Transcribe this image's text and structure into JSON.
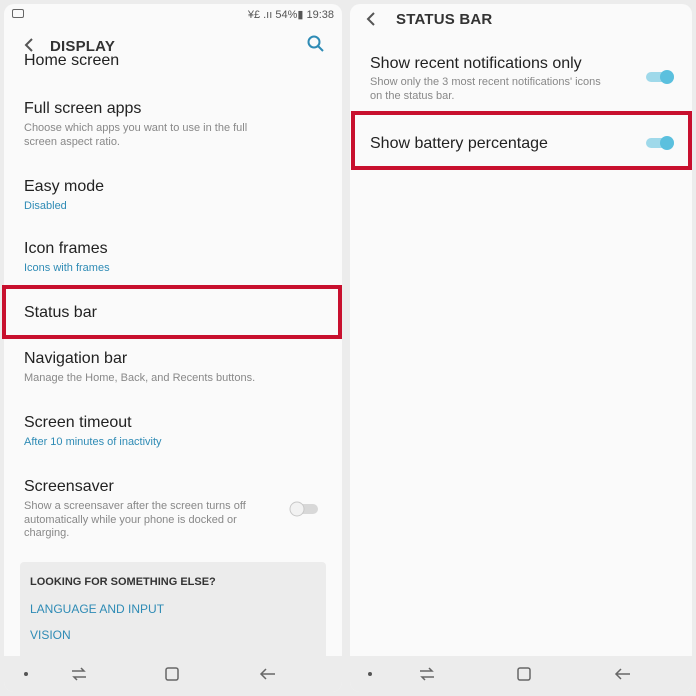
{
  "left": {
    "status": {
      "right_text": "¥£ .ıı 54%▮ 19:38"
    },
    "header": {
      "title": "DISPLAY"
    },
    "items": [
      {
        "title": "Home screen"
      },
      {
        "title": "Full screen apps",
        "subtitle": "Choose which apps you want to use in the full screen aspect ratio."
      },
      {
        "title": "Easy mode",
        "subtitle": "Disabled"
      },
      {
        "title": "Icon frames",
        "subtitle": "Icons with frames"
      },
      {
        "title": "Status bar"
      },
      {
        "title": "Navigation bar",
        "subtitle": "Manage the Home, Back, and Recents buttons."
      },
      {
        "title": "Screen timeout",
        "subtitle": "After 10 minutes of inactivity"
      },
      {
        "title": "Screensaver",
        "subtitle": "Show a screensaver after the screen turns off automatically while your phone is docked or charging.",
        "toggle": false
      }
    ],
    "card": {
      "heading": "LOOKING FOR SOMETHING ELSE?",
      "links": [
        "LANGUAGE AND INPUT",
        "VISION"
      ]
    }
  },
  "right": {
    "header": {
      "title": "STATUS BAR"
    },
    "items": [
      {
        "title": "Show recent notifications only",
        "subtitle": "Show only the 3 most recent notifications' icons on the status bar.",
        "toggle": true
      },
      {
        "title": "Show battery percentage",
        "toggle": true
      }
    ]
  },
  "colors": {
    "accent": "#2e8bb5",
    "toggle_on": "#5bc0de",
    "highlight": "#c8102e"
  },
  "icons": [
    "image-icon",
    "back-arrow-icon",
    "search-icon",
    "recents-icon",
    "home-icon",
    "back-icon"
  ]
}
